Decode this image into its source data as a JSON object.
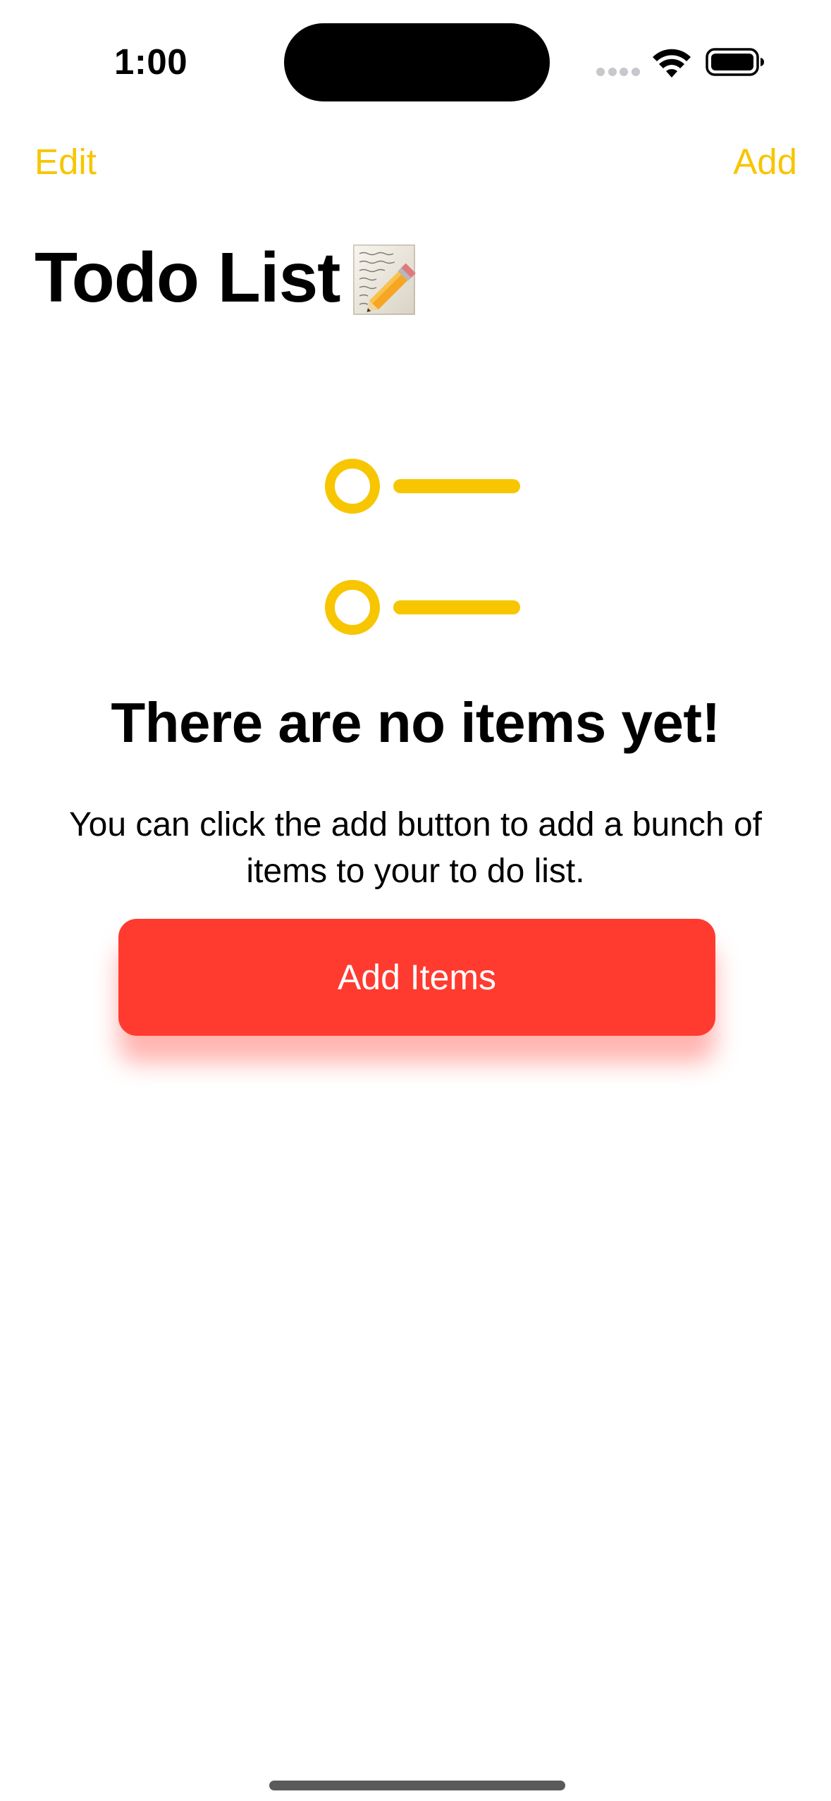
{
  "status_bar": {
    "time": "1:00"
  },
  "nav": {
    "edit_label": "Edit",
    "add_label": "Add"
  },
  "page": {
    "title": "Todo List"
  },
  "empty_state": {
    "title": "There are no items yet!",
    "message": "You can click the add button to add a bunch of items to your to do list.",
    "button_label": "Add Items"
  },
  "colors": {
    "accent": "#f7c600",
    "button_background": "#ff3b30",
    "button_text": "#ffffff"
  },
  "icons": [
    "wifi-icon",
    "battery-icon",
    "memo-icon",
    "list-icon"
  ]
}
